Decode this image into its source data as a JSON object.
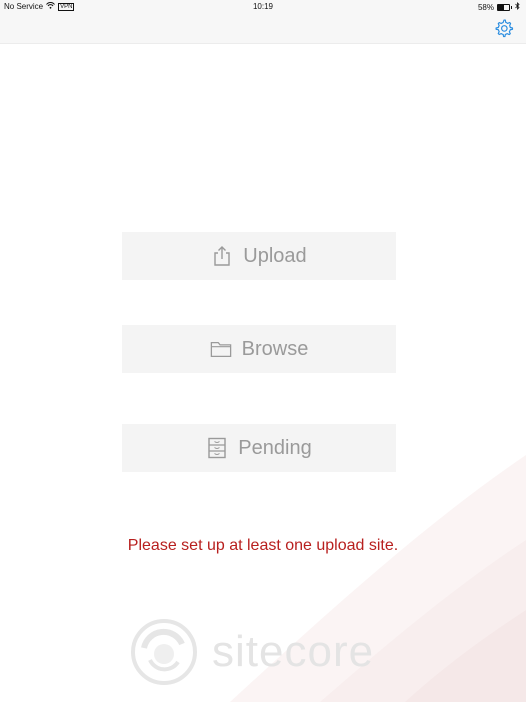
{
  "status_bar": {
    "carrier": "No Service",
    "network": "VPN",
    "time": "10:19",
    "battery": "58%",
    "battery_level": 0.58
  },
  "nav": {
    "settings_icon": "gear-icon"
  },
  "buttons": {
    "upload": {
      "label": "Upload",
      "icon": "upload-icon"
    },
    "browse": {
      "label": "Browse",
      "icon": "folder-icon"
    },
    "pending": {
      "label": "Pending",
      "icon": "cabinet-icon"
    }
  },
  "message": "Please set up at least one upload site.",
  "logo": {
    "text": "sitecore"
  },
  "colors": {
    "accent": "#2a8de0",
    "warning": "#b8201f",
    "button_bg": "#f4f4f4",
    "button_text": "#9a9a9a"
  }
}
